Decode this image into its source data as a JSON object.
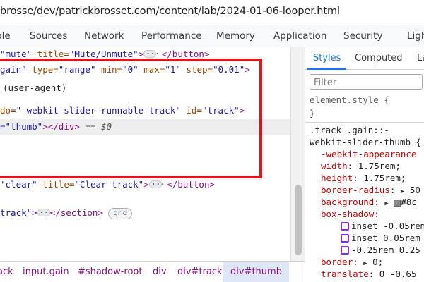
{
  "url": "brosse/dev/patrickbrosset.com/content/lab/2024-01-06-looper.html",
  "tabs": [
    "ble",
    "Sources",
    "Network",
    "Performance",
    "Memory",
    "Application",
    "Security",
    "Ligh"
  ],
  "elements": {
    "l1": {
      "v1": "\"mute\"",
      "a1": " title=",
      "v2": "\"Mute/Unmute\"",
      "t1": ">",
      "t2": "</button>"
    },
    "l2": {
      "v1": "gain\"",
      "a1": " type=",
      "v2": "\"range\"",
      "a2": " min=",
      "v3": "\"0\"",
      "a3": " max=",
      "v4": "\"1\"",
      "a4": " step=",
      "v5": "\"0.01\"",
      "t1": ">"
    },
    "l3": {
      "text": "(user-agent)"
    },
    "l4": {
      "a1": "do=",
      "v1": "\"-webkit-slider-runnable-track\"",
      "a2": " id=",
      "v2": "\"track\"",
      "t1": ">"
    },
    "l5": {
      "v1": "=\"thumb\"",
      "t1": "></div>",
      "eq": " == $0"
    },
    "l6": {
      "v1": "'clear\"",
      "a1": " title=",
      "v2": "\"Clear track\"",
      "t1": ">",
      "t2": "</button>"
    },
    "l7": {
      "v1": "track\"",
      "t1": ">",
      "t2": "</section>",
      "badge": "grid"
    }
  },
  "breadcrumbs": [
    "ack",
    "input.gain",
    "#shadow-root",
    "div",
    "div#track",
    "div#thumb"
  ],
  "styles_panel": {
    "tabs": [
      "Styles",
      "Computed",
      "La"
    ],
    "filter_placeholder": "Filter",
    "element_style": "element.style {",
    "close_brace": "}",
    "selector1": ".track .gain::-",
    "selector2": "webkit-slider-thumb {",
    "props": [
      {
        "name": "-webkit-appearance",
        "value": ""
      },
      {
        "name": "width",
        "value": "1.75rem;"
      },
      {
        "name": "height",
        "value": "1.75rem;"
      },
      {
        "name": "border-radius",
        "value": "50"
      },
      {
        "name": "background",
        "value": "#8c"
      },
      {
        "name": "box-shadow",
        "value": ""
      },
      {
        "name": "",
        "value": "inset -0.05rem"
      },
      {
        "name": "",
        "value": "inset 0.05rem"
      },
      {
        "name": "",
        "value": "-0.25rem 0.25"
      },
      {
        "name": "border",
        "value": "0;"
      },
      {
        "name": "translate",
        "value": "0 -0.65"
      }
    ]
  }
}
